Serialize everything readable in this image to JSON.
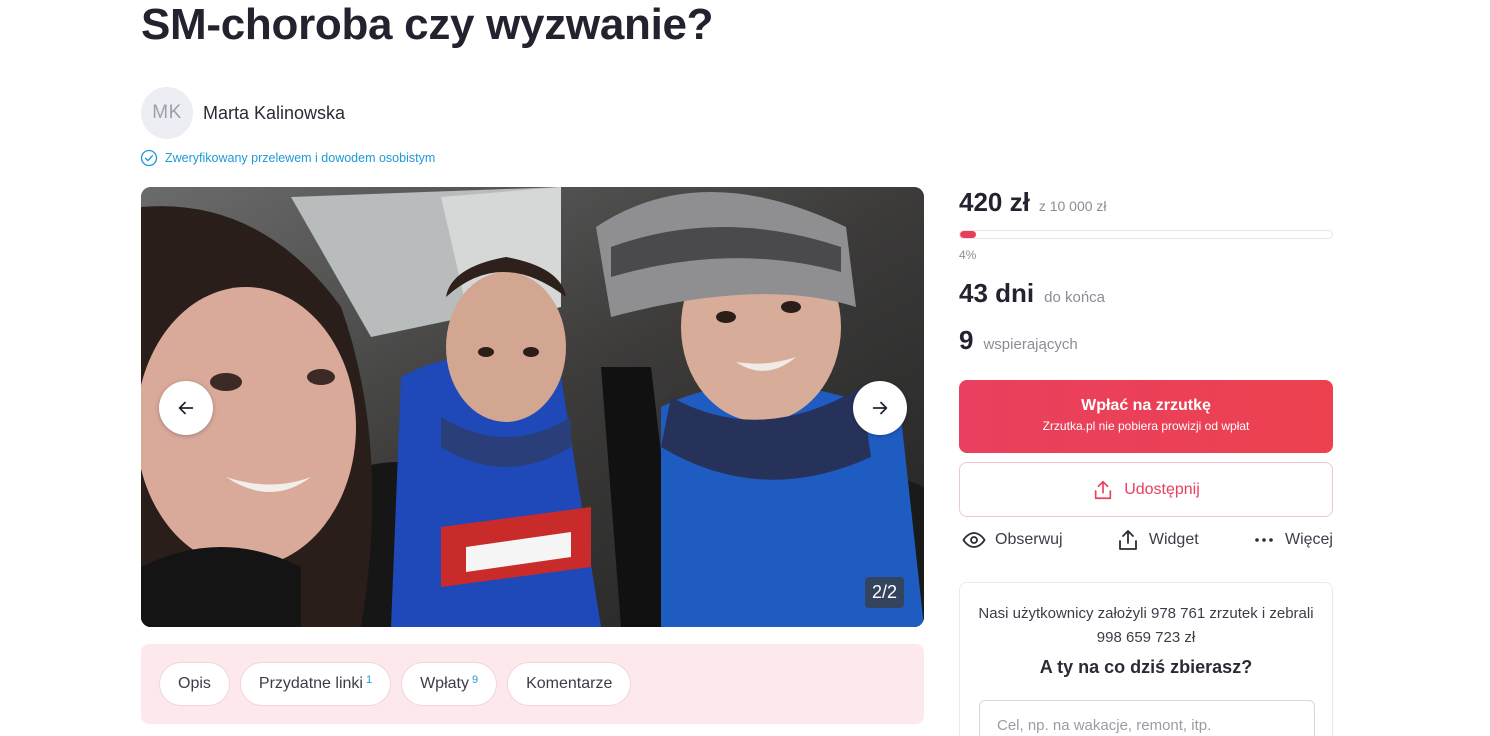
{
  "campaign": {
    "title": "SM-choroba czy wyzwanie?"
  },
  "author": {
    "initials": "MK",
    "name": "Marta Kalinowska",
    "verified_text": "Zweryfikowany przelewem i dowodem osobistym"
  },
  "gallery": {
    "counter": "2/2",
    "prev_icon": "arrow-left-icon",
    "next_icon": "arrow-right-icon"
  },
  "tabs": [
    {
      "label": "Opis",
      "count": ""
    },
    {
      "label": "Przydatne linki",
      "count": "1"
    },
    {
      "label": "Wpłaty",
      "count": "9"
    },
    {
      "label": "Komentarze",
      "count": ""
    }
  ],
  "funding": {
    "raised": "420 zł",
    "goal": "z 10 000 zł",
    "progress_fraction": 0.042,
    "percent_label": "4%",
    "days_value": "43 dni",
    "days_label": "do końca",
    "supporters_value": "9",
    "supporters_label": "wspierających"
  },
  "donate": {
    "label": "Wpłać na zrzutkę",
    "sublabel": "Zrzutka.pl nie pobiera prowizji od wpłat"
  },
  "share": {
    "label": "Udostępnij"
  },
  "actions": [
    {
      "label": "Obserwuj",
      "icon": "eye-icon"
    },
    {
      "label": "Widget",
      "icon": "share-upload-icon"
    },
    {
      "label": "Więcej",
      "icon": "more-dots-icon"
    }
  ],
  "promo": {
    "text": "Nasi użytkownicy założyli 978 761 zrzutek i zebrali 998 659 723 zł",
    "question": "A ty na co dziś zbierasz?",
    "input_placeholder": "Cel, np. na wakacje, remont, itp."
  },
  "colors": {
    "accent": "#e8405e",
    "verified": "#1d9bd6",
    "tabs_bg": "#fde9ec"
  }
}
